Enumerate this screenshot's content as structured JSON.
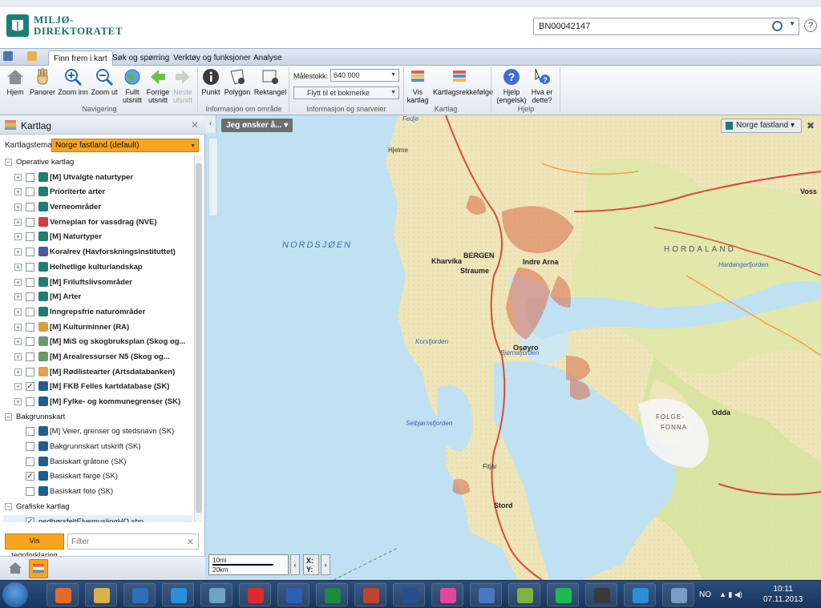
{
  "header": {
    "logo_line1": "MILJØ-",
    "logo_line2": "DIREKTORATET",
    "search_value": "BN00042147",
    "help_icon_text": "?"
  },
  "ribbon_tabs": [
    "Finn frem i kart",
    "Søk og spørring",
    "Verktøy og funksjoner",
    "Analyse"
  ],
  "ribbon": {
    "navigation": {
      "buttons": [
        "Hjem",
        "Panorer",
        "Zoom inn",
        "Zoom ut",
        "Fullt utsnitt",
        "Forrige utsnitt",
        "Neste utsnitt"
      ],
      "group_label": "Navigering"
    },
    "info": {
      "buttons": [
        "Punkt",
        "Polygon",
        "Rektangel"
      ],
      "group_label": "Informasjon om område"
    },
    "scale": {
      "label": "Målestokk: 1:",
      "value": "640 000",
      "bookmark_placeholder": "Flytt til et bokmerke",
      "group_label": "Informasjon og snarveier"
    },
    "kartlag": {
      "buttons": [
        "Vis kartlag",
        "Kartlagsrekkefølge"
      ],
      "group_label": "Kartlag"
    },
    "help": {
      "buttons": [
        "Hjelp (engelsk)",
        "Hva er dette?"
      ],
      "group_label": "Hjelp"
    }
  },
  "panel": {
    "title": "Kartlag",
    "theme_label": "Kartlagstema:",
    "theme_value": "Norge fastland (default)",
    "sections": [
      {
        "title": "Operative kartlag",
        "items": [
          {
            "label": "[M] Utvalgte naturtyper",
            "checked": false,
            "color": "#1f7d73",
            "bold": true
          },
          {
            "label": "Prioriterte arter",
            "checked": false,
            "color": "#1f7d73",
            "bold": true
          },
          {
            "label": "Verneområder",
            "checked": false,
            "color": "#1f7d73",
            "bold": true
          },
          {
            "label": "Verneplan for vassdrag (NVE)",
            "checked": false,
            "color": "#d33c3c",
            "bold": true
          },
          {
            "label": "[M] Naturtyper",
            "checked": false,
            "color": "#1f7d73",
            "bold": true
          },
          {
            "label": "Koralrev (Havforskningsinstituttet)",
            "checked": false,
            "color": "#4a5aa8",
            "bold": true
          },
          {
            "label": "Helhetlige kulturlandskap",
            "checked": false,
            "color": "#1f7d73",
            "bold": true
          },
          {
            "label": "[M] Friluftslivsområder",
            "checked": false,
            "color": "#1f7d73",
            "bold": true
          },
          {
            "label": "[M] Arter",
            "checked": false,
            "color": "#1f7d73",
            "bold": true
          },
          {
            "label": "Inngrepsfrie naturområder",
            "checked": false,
            "color": "#1f7d73",
            "bold": true
          },
          {
            "label": "[M] Kulturminner (RA)",
            "checked": false,
            "color": "#d5a23a",
            "bold": true
          },
          {
            "label": "[M] MiS og skogbruksplan (Skog og...",
            "checked": false,
            "color": "#6a9a6a",
            "bold": true
          },
          {
            "label": "[M] Arealressurser N5 (Skog og...",
            "checked": false,
            "color": "#6a9a6a",
            "bold": true
          },
          {
            "label": "[M] Rødlistearter (Artsdatabanken)",
            "checked": false,
            "color": "#e0a050",
            "bold": true
          },
          {
            "label": "[M] FKB Felles kartdatabase (SK)",
            "checked": true,
            "color": "#1f5f8f",
            "bold": true
          },
          {
            "label": "[M] Fylke- og kommunegrenser (SK)",
            "checked": false,
            "color": "#1f5f8f",
            "bold": true
          }
        ]
      },
      {
        "title": "Bakgrunnskart",
        "items": [
          {
            "label": "[M] Veier, grenser og stedsnavn (SK)",
            "checked": false,
            "color": "#1f5f8f",
            "bold": false
          },
          {
            "label": "Bakgrunnskart utskrift (SK)",
            "checked": false,
            "color": "#1f5f8f",
            "bold": false
          },
          {
            "label": "Basiskart gråtone (SK)",
            "checked": false,
            "color": "#1f5f8f",
            "bold": false
          },
          {
            "label": "Basiskart farge (SK)",
            "checked": true,
            "color": "#1f5f8f",
            "bold": false
          },
          {
            "label": "Basiskart foto (SK)",
            "checked": false,
            "color": "#1f5f8f",
            "bold": false
          }
        ]
      },
      {
        "title": "Grafiske kartlag",
        "items": [
          {
            "label": "nedbørsfeltElvemuslingHO.shp",
            "checked": true,
            "color": "",
            "bold": false
          }
        ]
      }
    ],
    "legend_button": "Vis tegnforklaring",
    "filter_placeholder": "Filter"
  },
  "map": {
    "jeg_onsker": "Jeg ønsker å...",
    "region": "Norge fastland",
    "scale_top": "10mi",
    "scale_bottom": "20km",
    "coord_x": "X:",
    "coord_y": "Y:",
    "labels": {
      "nordsjoen": "NORDSJØEN",
      "hordaland": "HORDALAND",
      "bergen": "BERGEN",
      "straume": "Straume",
      "kharvika": "Kharvika",
      "indre_arna": "Indre Arna",
      "osoyro": "Osøyro",
      "folgefonna1": "FOLGE-",
      "folgefonna2": "FONNA",
      "odda": "Odda",
      "voss": "Voss",
      "hardanger": "Hardangerfjorden",
      "bjornafjorden": "Bjørnafjorden",
      "selbjornsfjorden": "Selbjørnsfjorden",
      "korsfjorden": "Korsfjorden",
      "stord": "Stord",
      "fedje": "Fedje",
      "hjelme": "Hjelme",
      "fitjar": "Fitjar"
    }
  },
  "taskbar": {
    "lang": "NO",
    "time": "10:11",
    "date": "07.11.2013",
    "apps": [
      "Media",
      "Explorer",
      "Mail",
      "IE",
      "Notes",
      "Opera",
      "W",
      "X",
      "P",
      "Ps",
      "Cloud",
      "Box",
      "Q",
      "Spotify",
      "Lr",
      "IE",
      "Remote"
    ]
  }
}
